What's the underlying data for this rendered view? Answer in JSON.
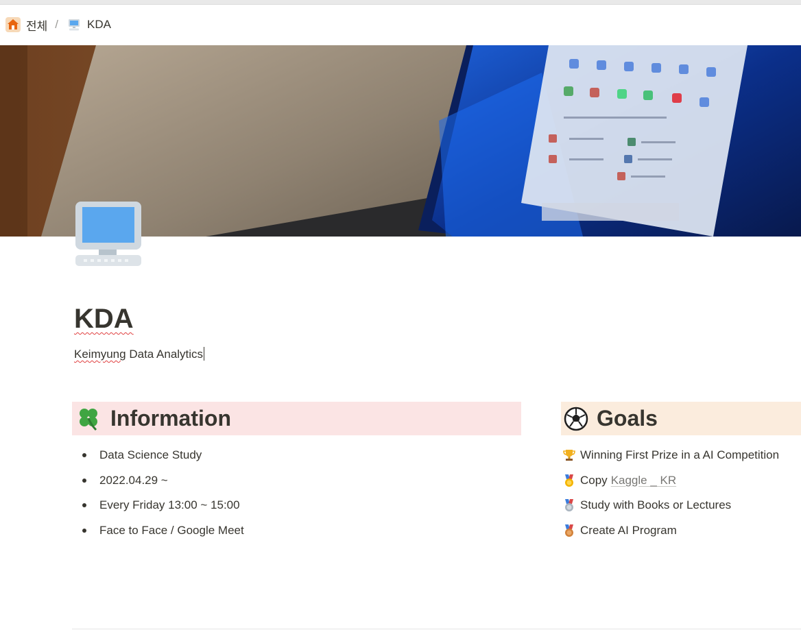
{
  "breadcrumb": {
    "items": [
      {
        "label": "전체",
        "icon": "house-icon"
      },
      {
        "label": "KDA",
        "icon": "desktop-computer-icon"
      }
    ],
    "separator": "/"
  },
  "cover": {
    "description_icon": "laptop-cover-image"
  },
  "page": {
    "icon": "desktop-computer-icon",
    "title": "KDA",
    "subtitle_underlined": "Keimyung",
    "subtitle_rest": " Data Analytics"
  },
  "information": {
    "heading": "Information",
    "icon": "four-leaf-clover-icon",
    "background": "#fbe4e4",
    "items": [
      "Data Science Study",
      "2022.04.29 ~",
      "Every Friday 13:00 ~ 15:00",
      "Face to Face / Google Meet"
    ]
  },
  "goals": {
    "heading": "Goals",
    "icon": "soccer-ball-icon",
    "background": "#fbecdd",
    "items": [
      {
        "icon": "trophy-icon",
        "text": "Winning First Prize in a AI Competition"
      },
      {
        "icon": "gold-medal-icon",
        "text": "Copy",
        "link": "Kaggle _ KR"
      },
      {
        "icon": "silver-medal-icon",
        "text": "Study with Books or Lectures"
      },
      {
        "icon": "bronze-medal-icon",
        "text": "Create AI Program"
      }
    ]
  }
}
